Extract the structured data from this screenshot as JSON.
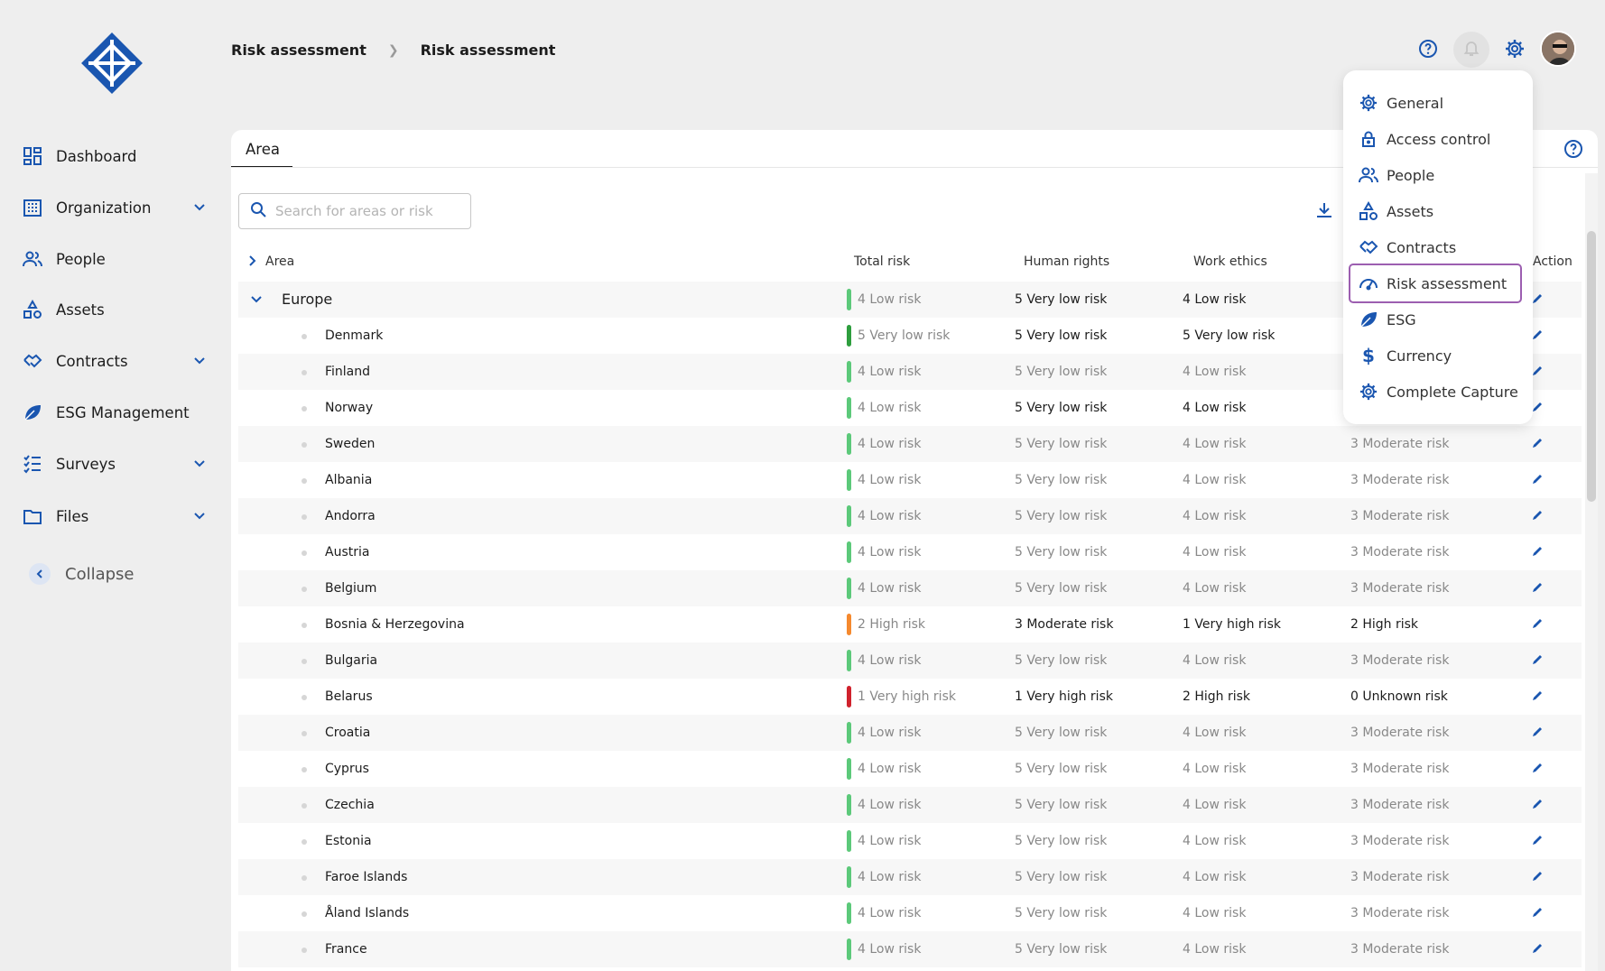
{
  "breadcrumb": {
    "root": "Risk assessment",
    "current": "Risk assessment"
  },
  "sidebar": {
    "items": [
      {
        "label": "Dashboard",
        "icon": "dashboard-icon"
      },
      {
        "label": "Organization",
        "icon": "building-icon",
        "expandable": true
      },
      {
        "label": "People",
        "icon": "people-icon"
      },
      {
        "label": "Assets",
        "icon": "assets-icon"
      },
      {
        "label": "Contracts",
        "icon": "handshake-icon",
        "expandable": true
      },
      {
        "label": "ESG Management",
        "icon": "leaf-icon"
      },
      {
        "label": "Surveys",
        "icon": "list-icon",
        "expandable": true
      },
      {
        "label": "Files",
        "icon": "folder-icon",
        "expandable": true
      }
    ],
    "collapse_label": "Collapse"
  },
  "main": {
    "tab_label": "Area",
    "search_placeholder": "Search for areas or risk",
    "columns": {
      "area": "Area",
      "total": "Total risk",
      "human": "Human rights",
      "work": "Work ethics",
      "action": "Action"
    },
    "group": {
      "name": "Europe",
      "total": "4 Low risk",
      "human": "5 Very low risk",
      "work": "4 Low risk"
    },
    "rows": [
      {
        "name": "Denmark",
        "total": "5 Very low risk",
        "human": "5 Very low risk",
        "work": "5 Very low risk",
        "c4": "",
        "level": "verylow",
        "strong": true
      },
      {
        "name": "Finland",
        "total": "4 Low risk",
        "human": "5 Very low risk",
        "work": "4 Low risk",
        "c4": "",
        "level": "low"
      },
      {
        "name": "Norway",
        "total": "4 Low risk",
        "human": "5 Very low risk",
        "work": "4 Low risk",
        "c4": "",
        "level": "low",
        "strong": true
      },
      {
        "name": "Sweden",
        "total": "4 Low risk",
        "human": "5 Very low risk",
        "work": "4 Low risk",
        "c4": "3 Moderate risk",
        "level": "low"
      },
      {
        "name": "Albania",
        "total": "4 Low risk",
        "human": "5 Very low risk",
        "work": "4 Low risk",
        "c4": "3 Moderate risk",
        "level": "low"
      },
      {
        "name": "Andorra",
        "total": "4 Low risk",
        "human": "5 Very low risk",
        "work": "4 Low risk",
        "c4": "3 Moderate risk",
        "level": "low"
      },
      {
        "name": "Austria",
        "total": "4 Low risk",
        "human": "5 Very low risk",
        "work": "4 Low risk",
        "c4": "3 Moderate risk",
        "level": "low"
      },
      {
        "name": "Belgium",
        "total": "4 Low risk",
        "human": "5 Very low risk",
        "work": "4 Low risk",
        "c4": "3 Moderate risk",
        "level": "low"
      },
      {
        "name": "Bosnia & Herzegovina",
        "total": "2 High risk",
        "human": "3 Moderate risk",
        "work": "1 Very high risk",
        "c4": "2 High risk",
        "level": "high",
        "strong": true
      },
      {
        "name": "Bulgaria",
        "total": "4 Low risk",
        "human": "5 Very low risk",
        "work": "4 Low risk",
        "c4": "3 Moderate risk",
        "level": "low"
      },
      {
        "name": "Belarus",
        "total": "1 Very high risk",
        "human": "1 Very high risk",
        "work": "2 High risk",
        "c4": "0 Unknown risk",
        "level": "veryhigh",
        "strong": true
      },
      {
        "name": "Croatia",
        "total": "4 Low risk",
        "human": "5 Very low risk",
        "work": "4 Low risk",
        "c4": "3 Moderate risk",
        "level": "low"
      },
      {
        "name": "Cyprus",
        "total": "4 Low risk",
        "human": "5 Very low risk",
        "work": "4 Low risk",
        "c4": "3 Moderate risk",
        "level": "low"
      },
      {
        "name": "Czechia",
        "total": "4 Low risk",
        "human": "5 Very low risk",
        "work": "4 Low risk",
        "c4": "3 Moderate risk",
        "level": "low"
      },
      {
        "name": "Estonia",
        "total": "4 Low risk",
        "human": "5 Very low risk",
        "work": "4 Low risk",
        "c4": "3 Moderate risk",
        "level": "low"
      },
      {
        "name": "Faroe Islands",
        "total": "4 Low risk",
        "human": "5 Very low risk",
        "work": "4 Low risk",
        "c4": "3 Moderate risk",
        "level": "low"
      },
      {
        "name": "Åland Islands",
        "total": "4 Low risk",
        "human": "5 Very low risk",
        "work": "4 Low risk",
        "c4": "3 Moderate risk",
        "level": "low"
      },
      {
        "name": "France",
        "total": "4 Low risk",
        "human": "5 Very low risk",
        "work": "4 Low risk",
        "c4": "3 Moderate risk",
        "level": "low"
      }
    ]
  },
  "level_colors": {
    "verylow": "#2e9e3e",
    "low": "#5cc97a",
    "high": "#f5892e",
    "veryhigh": "#d0222d"
  },
  "settings_menu": {
    "items": [
      {
        "label": "General",
        "icon": "gear-icon"
      },
      {
        "label": "Access control",
        "icon": "lock-icon"
      },
      {
        "label": "People",
        "icon": "people-icon"
      },
      {
        "label": "Assets",
        "icon": "assets-icon"
      },
      {
        "label": "Contracts",
        "icon": "handshake-icon"
      },
      {
        "label": "Risk assessment",
        "icon": "gauge-icon",
        "selected": true
      },
      {
        "label": "ESG",
        "icon": "leaf-icon"
      },
      {
        "label": "Currency",
        "icon": "dollar-icon"
      },
      {
        "label": "Complete Capture",
        "icon": "gear-icon"
      }
    ]
  },
  "colors": {
    "accent": "#1a56b0",
    "highlight": "#9c5eb0"
  }
}
